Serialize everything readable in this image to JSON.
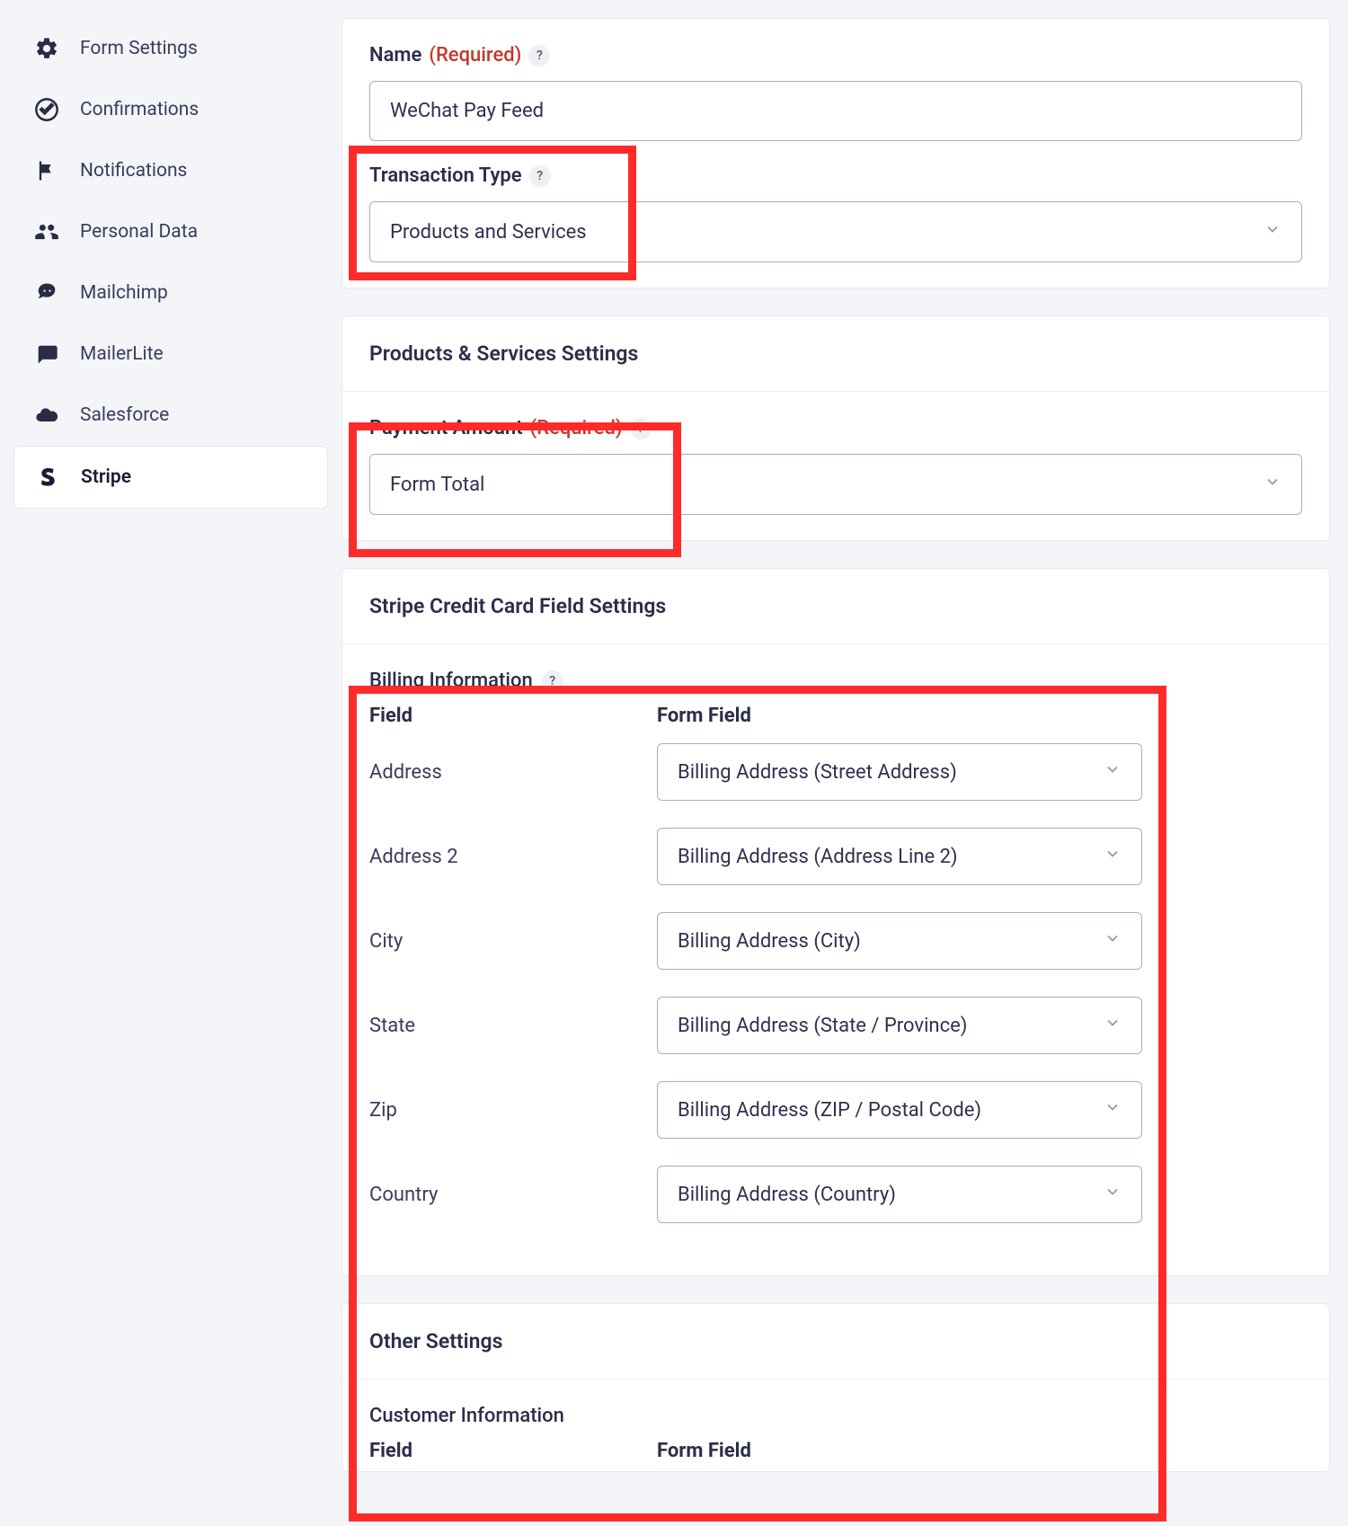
{
  "sidebar": {
    "items": [
      {
        "label": "Form Settings",
        "icon": "gear"
      },
      {
        "label": "Confirmations",
        "icon": "check-circle"
      },
      {
        "label": "Notifications",
        "icon": "flag"
      },
      {
        "label": "Personal Data",
        "icon": "users"
      },
      {
        "label": "Mailchimp",
        "icon": "mailchimp"
      },
      {
        "label": "MailerLite",
        "icon": "chat"
      },
      {
        "label": "Salesforce",
        "icon": "cloud"
      },
      {
        "label": "Stripe",
        "icon": "stripe"
      }
    ],
    "active_index": 7
  },
  "section_feed": {
    "name_label": "Name",
    "name_required": "(Required)",
    "name_value": "WeChat Pay Feed",
    "trans_label": "Transaction Type",
    "trans_value": "Products and Services"
  },
  "section_products": {
    "title": "Products & Services Settings",
    "pay_label": "Payment Amount",
    "pay_required": "(Required)",
    "pay_value": "Form Total"
  },
  "section_ccfields": {
    "title": "Stripe Credit Card Field Settings",
    "billing_label": "Billing Information",
    "col_field": "Field",
    "col_form": "Form Field",
    "rows": [
      {
        "field": "Address",
        "form": "Billing Address (Street Address)"
      },
      {
        "field": "Address 2",
        "form": "Billing Address (Address Line 2)"
      },
      {
        "field": "City",
        "form": "Billing Address (City)"
      },
      {
        "field": "State",
        "form": "Billing Address (State / Province)"
      },
      {
        "field": "Zip",
        "form": "Billing Address (ZIP / Postal Code)"
      },
      {
        "field": "Country",
        "form": "Billing Address (Country)"
      }
    ]
  },
  "section_other": {
    "title": "Other Settings",
    "customer_label": "Customer Information",
    "col_field": "Field",
    "col_form": "Form Field"
  }
}
